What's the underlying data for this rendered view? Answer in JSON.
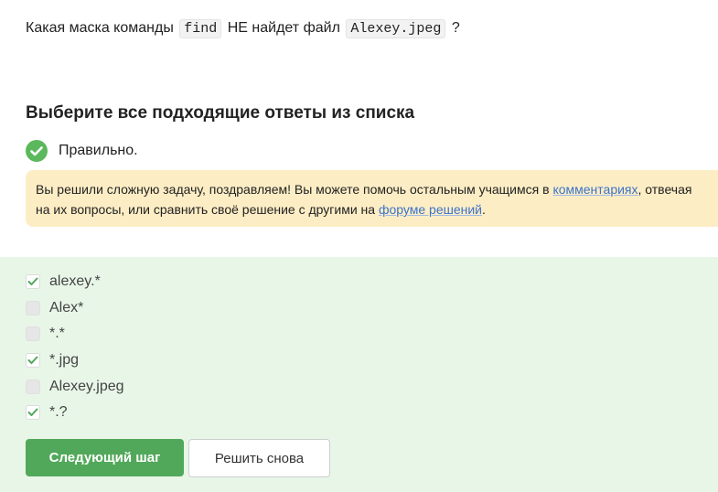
{
  "question": {
    "text_before": "Какая маска команды",
    "command": "find",
    "text_middle": "НЕ найдет файл",
    "filename": "Alexey.jpeg",
    "text_after": "?"
  },
  "heading": "Выберите все подходящие ответы из списка",
  "status": {
    "text": "Правильно.",
    "color": "#5bb85c"
  },
  "banner": {
    "part1": "Вы решили сложную задачу, поздравляем! Вы можете помочь остальным учащимся в",
    "link1": "комментариях",
    "part2": ", отвечая",
    "part3": "на их вопросы, или сравнить своё решение с другими на",
    "link2": "форуме решений",
    "part4": ".",
    "background": "#fdedc5"
  },
  "options": [
    {
      "label": "alexey.*",
      "checked": true
    },
    {
      "label": "Alex*",
      "checked": false
    },
    {
      "label": "*.*",
      "checked": false
    },
    {
      "label": "*.jpg",
      "checked": true
    },
    {
      "label": "Alexey.jpeg",
      "checked": false
    },
    {
      "label": "*.?",
      "checked": true
    }
  ],
  "buttons": {
    "next": "Следующий шаг",
    "retry": "Решить снова"
  }
}
